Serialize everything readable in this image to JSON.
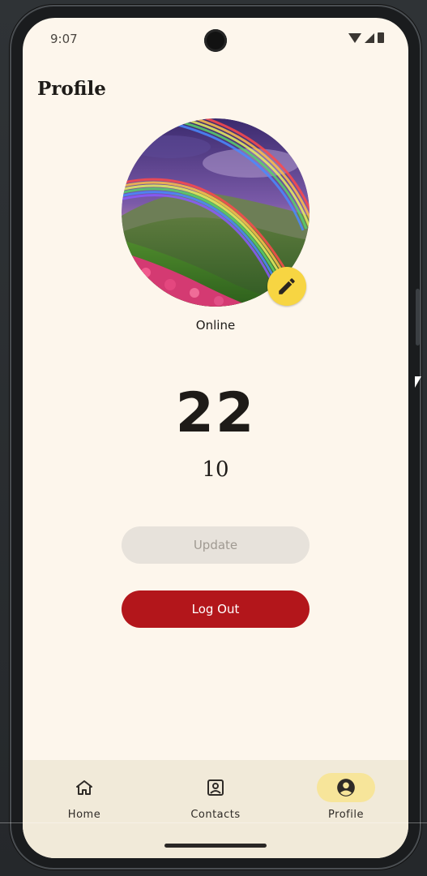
{
  "status_bar": {
    "time": "9:07",
    "icons": [
      "wifi-icon",
      "signal-icon",
      "battery-icon"
    ]
  },
  "header": {
    "title": "Profile"
  },
  "profile": {
    "avatar_description": "rainbow-over-mountain-meadow",
    "edit_icon": "pencil-icon",
    "status": "Online",
    "primary_number": "22",
    "secondary_number": "10"
  },
  "actions": {
    "update_label": "Update",
    "logout_label": "Log Out"
  },
  "bottom_nav": {
    "items": [
      {
        "label": "Home",
        "icon": "home-icon",
        "active": false
      },
      {
        "label": "Contacts",
        "icon": "contacts-icon",
        "active": false
      },
      {
        "label": "Profile",
        "icon": "profile-icon",
        "active": true
      }
    ]
  },
  "colors": {
    "background": "#fdf6ec",
    "accent_yellow": "#f7d542",
    "logout_red": "#b3161b",
    "nav_active": "#f7e59a"
  }
}
